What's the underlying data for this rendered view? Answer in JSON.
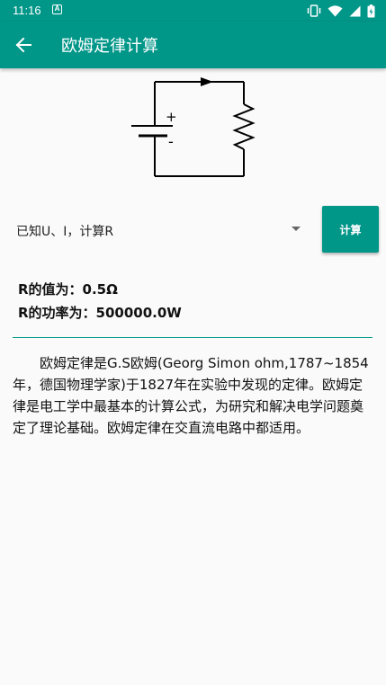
{
  "status_bar": {
    "time": "11:16",
    "notification_glyph": "A",
    "icons": [
      "vibrate-icon",
      "wifi-icon",
      "signal-icon",
      "battery-charging-icon"
    ]
  },
  "toolbar": {
    "back_icon": "arrow-back-icon",
    "title": "欧姆定律计算"
  },
  "circuit": {
    "plus_label": "+",
    "minus_label": "-"
  },
  "calculator": {
    "mode_selected": "已知U、I，计算R",
    "calculate_label": "计算"
  },
  "results": {
    "resistance": "R的值为：0.5Ω",
    "power": "R的功率为：500000.0W"
  },
  "description": "欧姆定律是G.S欧姆(Georg Simon ohm,1787~1854年，德国物理学家)于1827年在实验中发现的定律。欧姆定律是电工学中最基本的计算公式，为研究和解决电学问题奠定了理论基础。欧姆定律在交直流电路中都适用。",
  "colors": {
    "primary": "#009688",
    "background": "#fafafa",
    "text": "#111111"
  }
}
